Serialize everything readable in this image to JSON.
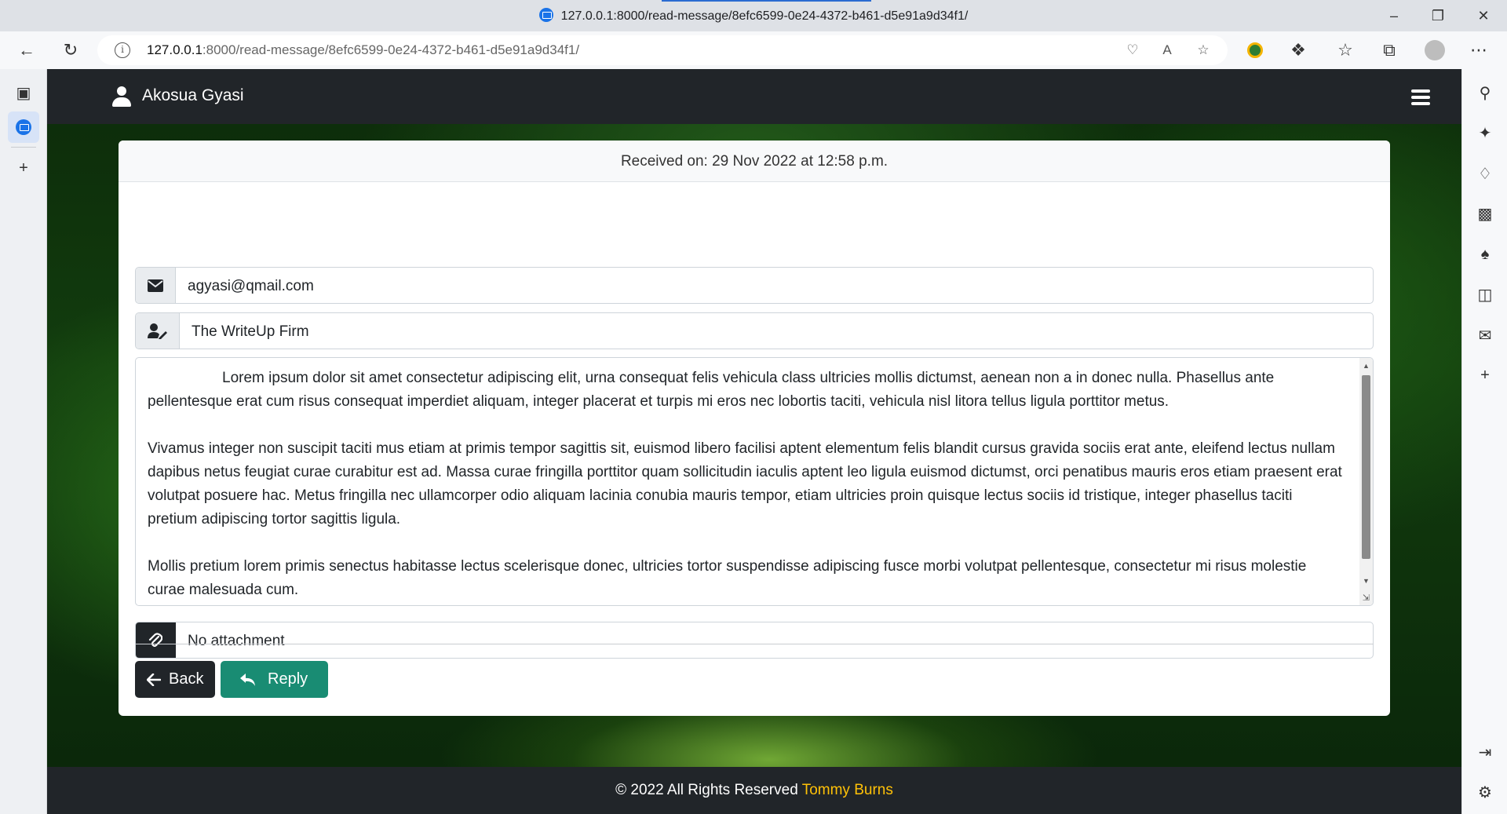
{
  "browser": {
    "tab_title": "127.0.0.1:8000/read-message/8efc6599-0e24-4372-b461-d5e91a9d34f1/",
    "url_host": "127.0.0.1",
    "url_path": ":8000/read-message/8efc6599-0e24-4372-b461-d5e91a9d34f1/"
  },
  "navbar": {
    "username": "Akosua Gyasi"
  },
  "message": {
    "received_label": "Received on: 29 Nov 2022 at 12:58 p.m.",
    "sender_email": "agyasi@qmail.com",
    "company": "The WriteUp Firm",
    "body": "                  Lorem ipsum dolor sit amet consectetur adipiscing elit, urna consequat felis vehicula class ultricies mollis dictumst, aenean non a in donec nulla. Phasellus ante pellentesque erat cum risus consequat imperdiet aliquam, integer placerat et turpis mi eros nec lobortis taciti, vehicula nisl litora tellus ligula porttitor metus.\n\nVivamus integer non suscipit taciti mus etiam at primis tempor sagittis sit, euismod libero facilisi aptent elementum felis blandit cursus gravida sociis erat ante, eleifend lectus nullam dapibus netus feugiat curae curabitur est ad. Massa curae fringilla porttitor quam sollicitudin iaculis aptent leo ligula euismod dictumst, orci penatibus mauris eros etiam praesent erat volutpat posuere hac. Metus fringilla nec ullamcorper odio aliquam lacinia conubia mauris tempor, etiam ultricies proin quisque lectus sociis id tristique, integer phasellus taciti pretium adipiscing tortor sagittis ligula.\n\nMollis pretium lorem primis senectus habitasse lectus scelerisque donec, ultricies tortor suspendisse adipiscing fusce morbi volutpat pellentesque, consectetur mi risus molestie curae malesuada cum.",
    "attachment": "No attachment"
  },
  "actions": {
    "back_label": "Back",
    "reply_label": "Reply"
  },
  "footer": {
    "copyright": "© 2022 All Rights Reserved ",
    "brand": "Tommy Burns"
  },
  "colors": {
    "navbar": "#212529",
    "reply_button": "#198c73",
    "footer_brand": "#ffc107"
  }
}
